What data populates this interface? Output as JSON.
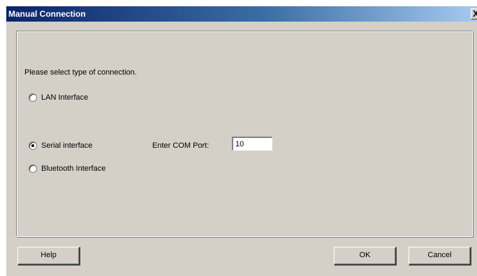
{
  "window": {
    "title": "Manual Connection",
    "close_glyph": "X"
  },
  "form": {
    "prompt": "Please select type of connection.",
    "options": [
      {
        "label": "LAN Interface",
        "checked": false
      },
      {
        "label": "Serial interface",
        "checked": true
      },
      {
        "label": "Bluetooth Interface",
        "checked": false
      }
    ],
    "com_port_label": "Enter COM Port:",
    "com_port_value": "10"
  },
  "buttons": {
    "help": "Help",
    "ok": "OK",
    "cancel": "Cancel"
  },
  "colors": {
    "face": "#d4d0c8",
    "title_start": "#0a246a",
    "title_end": "#a6caf0"
  },
  "icons": {
    "close": "close-icon"
  }
}
